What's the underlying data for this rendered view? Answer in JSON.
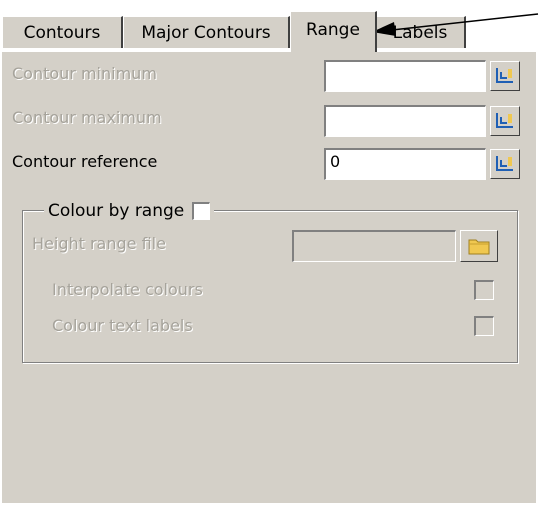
{
  "tabs": [
    {
      "label": "Contours"
    },
    {
      "label": "Major Contours"
    },
    {
      "label": "Range"
    },
    {
      "label": "Labels"
    }
  ],
  "fields": {
    "contour_minimum": {
      "label": "Contour minimum",
      "value": ""
    },
    "contour_maximum": {
      "label": "Contour maximum",
      "value": ""
    },
    "contour_reference": {
      "label": "Contour reference",
      "value": "0"
    }
  },
  "colour_group": {
    "label": "Colour by range",
    "checked": false,
    "height_range_file": {
      "label": "Height range file",
      "value": ""
    },
    "interpolate_colours": {
      "label": "Interpolate colours",
      "checked": false
    },
    "colour_text_labels": {
      "label": "Colour text labels",
      "checked": false
    }
  },
  "colors": {
    "dialog_bg": "#d4d0c8",
    "disabled_text": "#a6a39b",
    "pick_icon": "#1f5fb4",
    "folder_icon": "#f0c850"
  }
}
